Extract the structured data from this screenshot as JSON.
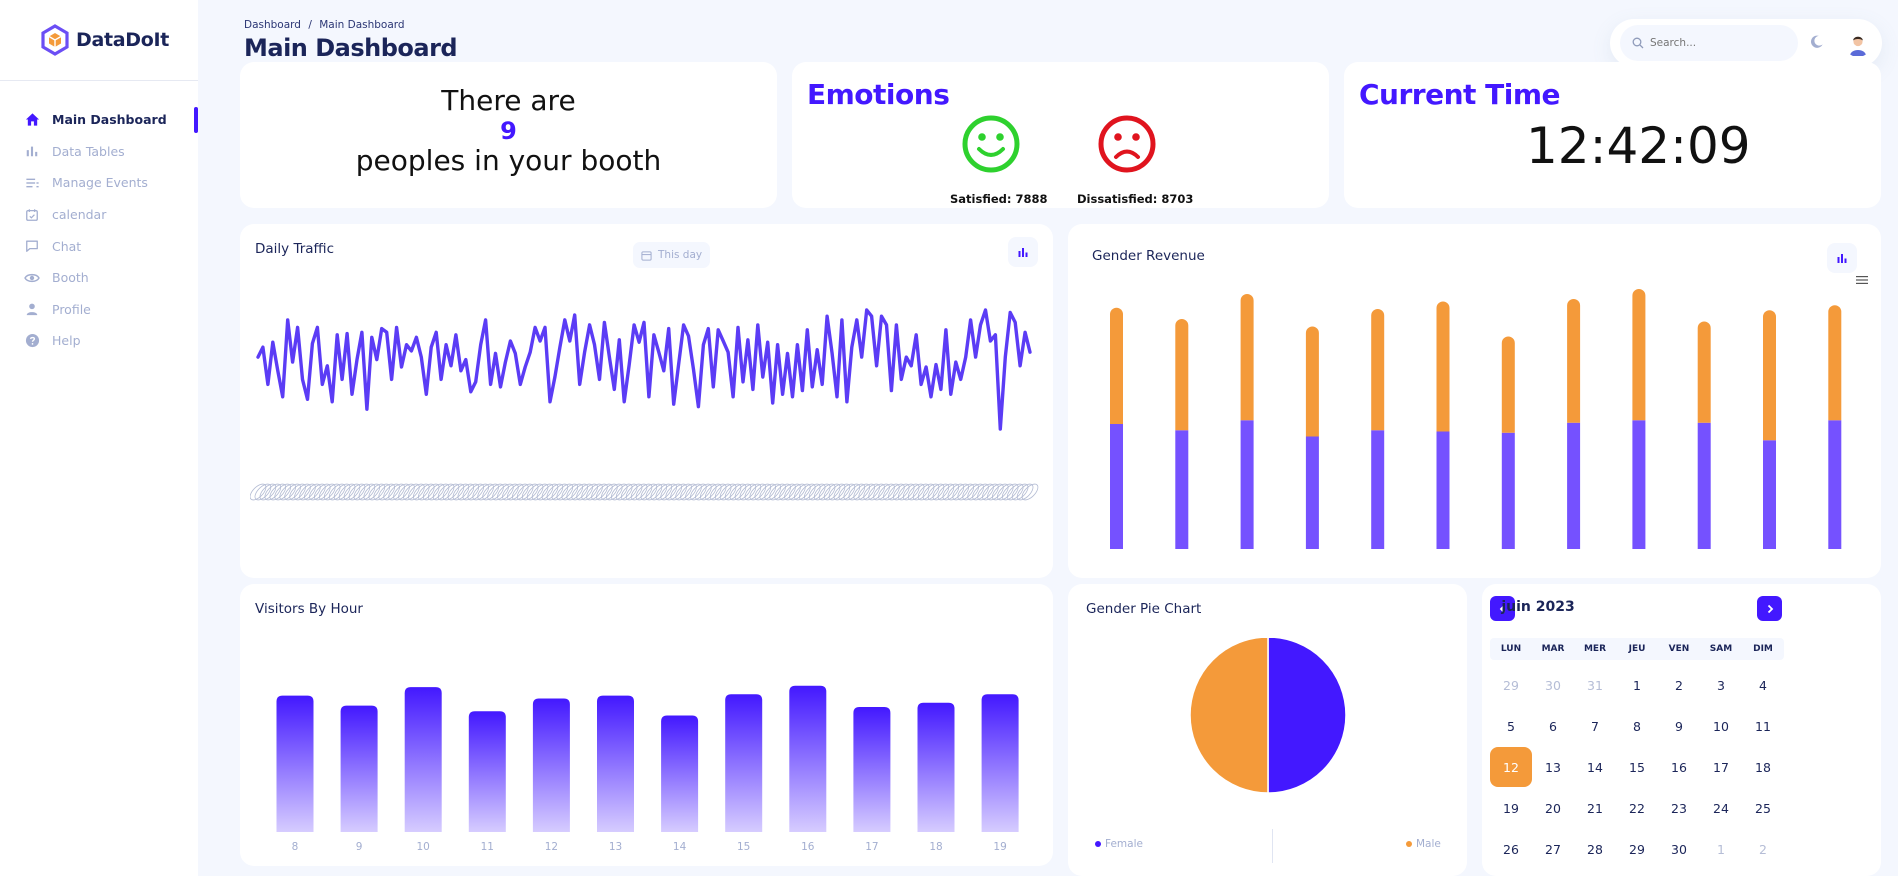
{
  "app": {
    "name": "DataDoIt"
  },
  "sidebar": {
    "items": [
      {
        "label": "Main Dashboard",
        "icon": "home-icon",
        "active": true
      },
      {
        "label": "Data Tables",
        "icon": "bar-chart-icon"
      },
      {
        "label": "Manage Events",
        "icon": "list-icon"
      },
      {
        "label": "calendar",
        "icon": "calendar-icon"
      },
      {
        "label": "Chat",
        "icon": "chat-icon"
      },
      {
        "label": "Booth",
        "icon": "eye-icon"
      },
      {
        "label": "Profile",
        "icon": "person-icon"
      },
      {
        "label": "Help",
        "icon": "help-icon"
      }
    ]
  },
  "header": {
    "breadcrumb_root": "Dashboard",
    "breadcrumb_sep": "/",
    "breadcrumb_current": "Main Dashboard",
    "title": "Main Dashboard",
    "search_placeholder": "Search..."
  },
  "booth": {
    "line1": "There are",
    "count": "9",
    "line2": "peoples in your booth"
  },
  "emotions": {
    "title": "Emotions",
    "satisfied_label": "Satisfied: 7888",
    "dissatisfied_label": "Dissatisfied: 8703",
    "colors": {
      "satisfied": "#2ed12e",
      "dissatisfied": "#e0141e"
    }
  },
  "current_time": {
    "title": "Current Time",
    "value": "12:42:09"
  },
  "daily_traffic": {
    "title": "Daily Traffic",
    "range_label": "This day"
  },
  "gender_revenue": {
    "title": "Gender Revenue"
  },
  "visitors_by_hour": {
    "title": "Visitors By Hour"
  },
  "gender_pie": {
    "title": "Gender Pie Chart",
    "legend_female": "Female",
    "legend_male": "Male"
  },
  "calendar": {
    "month_label": "juin 2023",
    "weekdays": [
      "LUN",
      "MAR",
      "MER",
      "JEU",
      "VEN",
      "SAM",
      "DIM"
    ],
    "weeks": [
      [
        [
          "29",
          1
        ],
        [
          "30",
          1
        ],
        [
          "31",
          1
        ],
        [
          "1",
          0
        ],
        [
          "2",
          0
        ],
        [
          "3",
          0
        ],
        [
          "4",
          0
        ]
      ],
      [
        [
          "5",
          0
        ],
        [
          "6",
          0
        ],
        [
          "7",
          0
        ],
        [
          "8",
          0
        ],
        [
          "9",
          0
        ],
        [
          "10",
          0
        ],
        [
          "11",
          0
        ]
      ],
      [
        [
          "12",
          2
        ],
        [
          "13",
          0
        ],
        [
          "14",
          0
        ],
        [
          "15",
          0
        ],
        [
          "16",
          0
        ],
        [
          "17",
          0
        ],
        [
          "18",
          0
        ]
      ],
      [
        [
          "19",
          0
        ],
        [
          "20",
          0
        ],
        [
          "21",
          0
        ],
        [
          "22",
          0
        ],
        [
          "23",
          0
        ],
        [
          "24",
          0
        ],
        [
          "25",
          0
        ]
      ],
      [
        [
          "26",
          0
        ],
        [
          "27",
          0
        ],
        [
          "28",
          0
        ],
        [
          "29",
          0
        ],
        [
          "30",
          0
        ],
        [
          "1",
          1
        ],
        [
          "2",
          1
        ]
      ]
    ]
  },
  "colors": {
    "accent": "#4318ff",
    "orange": "#f49a3a",
    "purple_bar": "#7551ff"
  },
  "chart_data": [
    {
      "type": "line",
      "name": "daily-traffic",
      "values": [
        62,
        70,
        40,
        74,
        51,
        30,
        92,
        58,
        86,
        44,
        28,
        73,
        86,
        40,
        55,
        26,
        80,
        44,
        81,
        32,
        60,
        82,
        20,
        78,
        60,
        85,
        82,
        44,
        86,
        54,
        72,
        67,
        78,
        62,
        32,
        70,
        82,
        44,
        72,
        55,
        80,
        51,
        60,
        34,
        42,
        72,
        92,
        40,
        65,
        38,
        58,
        75,
        65,
        40,
        54,
        66,
        86,
        75,
        86,
        26,
        46,
        70,
        92,
        75,
        96,
        40,
        66,
        88,
        72,
        44,
        90,
        62,
        36,
        76,
        26,
        56,
        88,
        74,
        90,
        30,
        80,
        66,
        51,
        85,
        24,
        56,
        88,
        79,
        52,
        22,
        72,
        85,
        38,
        84,
        75,
        66,
        30,
        86,
        42,
        76,
        36,
        88,
        46,
        74,
        25,
        72,
        32,
        65,
        30,
        72,
        35,
        84,
        38,
        68,
        40,
        95,
        65,
        30,
        92,
        26,
        70,
        92,
        62,
        100,
        95,
        55,
        95,
        88,
        35,
        88,
        44,
        62,
        55,
        80,
        40,
        54,
        30,
        56,
        36,
        84,
        32,
        58,
        44,
        62,
        92,
        62,
        88,
        100,
        75,
        80,
        4,
        62,
        98,
        90,
        55,
        82,
        66
      ]
    },
    {
      "type": "bar",
      "name": "gender-revenue",
      "stacked": true,
      "series": [
        {
          "values": [
            100,
            95,
            103,
            90,
            95,
            94,
            93,
            101,
            103,
            101,
            87,
            103
          ]
        },
        {
          "values": [
            93,
            89,
            101,
            88,
            97,
            104,
            77,
            99,
            105,
            81,
            104,
            92
          ]
        }
      ]
    },
    {
      "type": "bar",
      "name": "visitors-by-hour",
      "categories": [
        "8",
        "9",
        "10",
        "11",
        "12",
        "13",
        "14",
        "15",
        "16",
        "17",
        "18",
        "19"
      ],
      "values": [
        96,
        89,
        102,
        85,
        94,
        96,
        82,
        97,
        103,
        88,
        91,
        97
      ]
    },
    {
      "type": "pie",
      "name": "gender-pie",
      "labels": [
        "Female",
        "Male"
      ],
      "values": [
        50,
        50
      ],
      "colors": [
        "#4318ff",
        "#f49a3a"
      ]
    }
  ]
}
